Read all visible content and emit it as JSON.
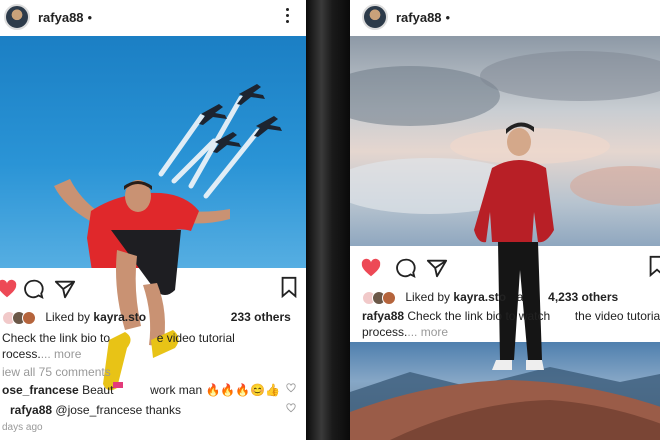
{
  "colors": {
    "heart": "#ed4956",
    "text": "#262626",
    "muted": "#999999"
  },
  "left_post": {
    "username": "rafya88",
    "liked_prefix": "Liked by",
    "liked_user": "kayra.sto",
    "liked_suffix": "233 others",
    "caption_line1": "Check the link bio to",
    "caption_line1b": "e video tutorial",
    "caption_line2": "rocess.",
    "more": "... more",
    "view_comments": "iew all 75 comments",
    "comment1_user": "ose_francese",
    "comment1_text": "Beaut",
    "comment1_text2": "work man 🔥🔥🔥😊👍",
    "comment2_user": "rafya88",
    "comment2_text": "@jose_francese thanks",
    "timestamp": "days ago",
    "icons": [
      "heart-icon",
      "comment-icon",
      "send-icon",
      "bookmark-icon",
      "more-icon"
    ]
  },
  "right_post": {
    "username": "rafya88",
    "liked_prefix": "Liked by",
    "liked_user": "kayra.sto",
    "liked_middle": "a",
    "liked_suffix": "4,233 others",
    "caption_user": "rafya88",
    "caption_text": "Check the link bio to",
    "caption_text2": "watch",
    "caption_text3": "the video tutorial",
    "caption_line2": "process.",
    "more": "... more",
    "icons": [
      "heart-icon",
      "comment-icon",
      "send-icon",
      "bookmark-icon",
      "more-icon"
    ]
  }
}
